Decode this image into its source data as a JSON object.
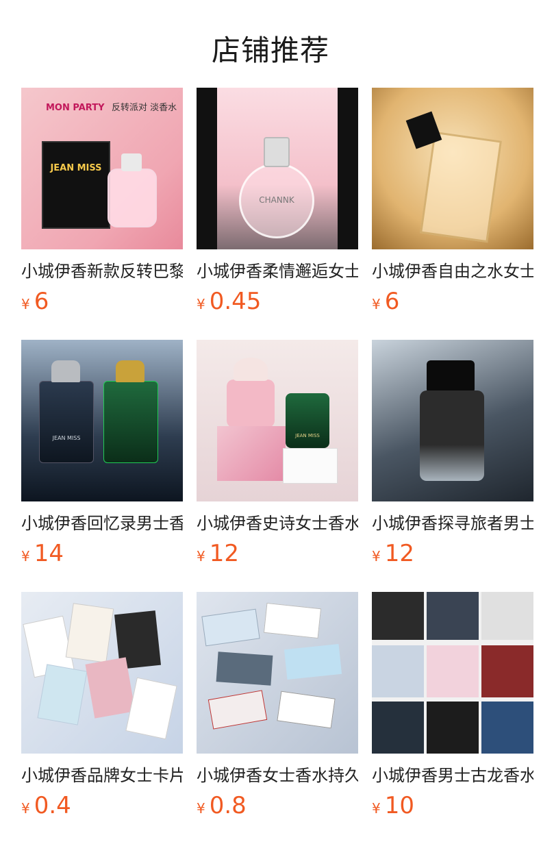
{
  "header": {
    "title": "店铺推荐"
  },
  "colors": {
    "price": "#f15a22",
    "title": "#1a1a1a"
  },
  "currency_symbol": "¥",
  "products": [
    {
      "name": "小城伊香新款反转巴黎",
      "price": "6",
      "image_text": {
        "brand": "MON PARTY",
        "tagline": "反转派对 淡香水",
        "box": "JEAN MISS"
      }
    },
    {
      "name": "小城伊香柔情邂逅女士",
      "price": "0.45",
      "image_text": {
        "bottle": "CHANNK"
      }
    },
    {
      "name": "小城伊香自由之水女士",
      "price": "6",
      "image_text": {}
    },
    {
      "name": "小城伊香回忆录男士香",
      "price": "14",
      "image_text": {
        "bottle": "JEAN MISS"
      }
    },
    {
      "name": "小城伊香史诗女士香水",
      "price": "12",
      "image_text": {
        "bottle": "JEAN MISS"
      }
    },
    {
      "name": "小城伊香探寻旅者男士",
      "price": "12",
      "image_text": {}
    },
    {
      "name": "小城伊香品牌女士卡片",
      "price": "0.4",
      "image_text": {}
    },
    {
      "name": "小城伊香女士香水持久",
      "price": "0.8",
      "image_text": {}
    },
    {
      "name": "小城伊香男士古龙香水",
      "price": "10",
      "image_text": {}
    }
  ]
}
